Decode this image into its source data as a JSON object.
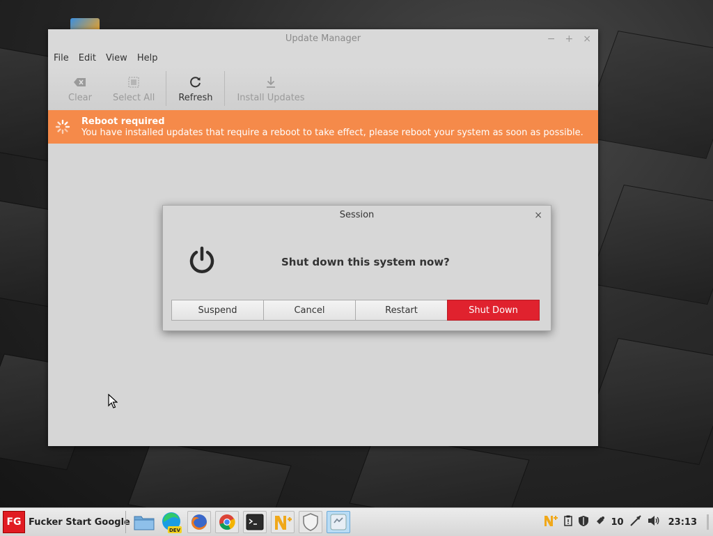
{
  "update_manager": {
    "title": "Update Manager",
    "menu": [
      "File",
      "Edit",
      "View",
      "Help"
    ],
    "toolbar": {
      "clear_label": "Clear",
      "select_all_label": "Select All",
      "refresh_label": "Refresh",
      "install_label": "Install Updates"
    },
    "notice": {
      "title": "Reboot required",
      "message": "You have installed updates that require a reboot to take effect, please reboot your system as soon as possible.",
      "color": "#f58a4a"
    }
  },
  "session_dialog": {
    "title": "Session",
    "question": "Shut down this system now?",
    "buttons": {
      "suspend": "Suspend",
      "cancel": "Cancel",
      "restart": "Restart",
      "shutdown": "Shut Down"
    },
    "danger_color": "#e0222e"
  },
  "taskbar": {
    "start_logo": "FG",
    "start_label": "Fucker Start Google",
    "launchers": [
      "files-icon",
      "edge-dev-icon",
      "firefox-icon",
      "chrome-icon",
      "terminal-icon",
      "n-plus-icon",
      "shield-icon",
      "update-manager-icon"
    ],
    "tray": {
      "notification_count": "10",
      "clock": "23:13"
    }
  }
}
